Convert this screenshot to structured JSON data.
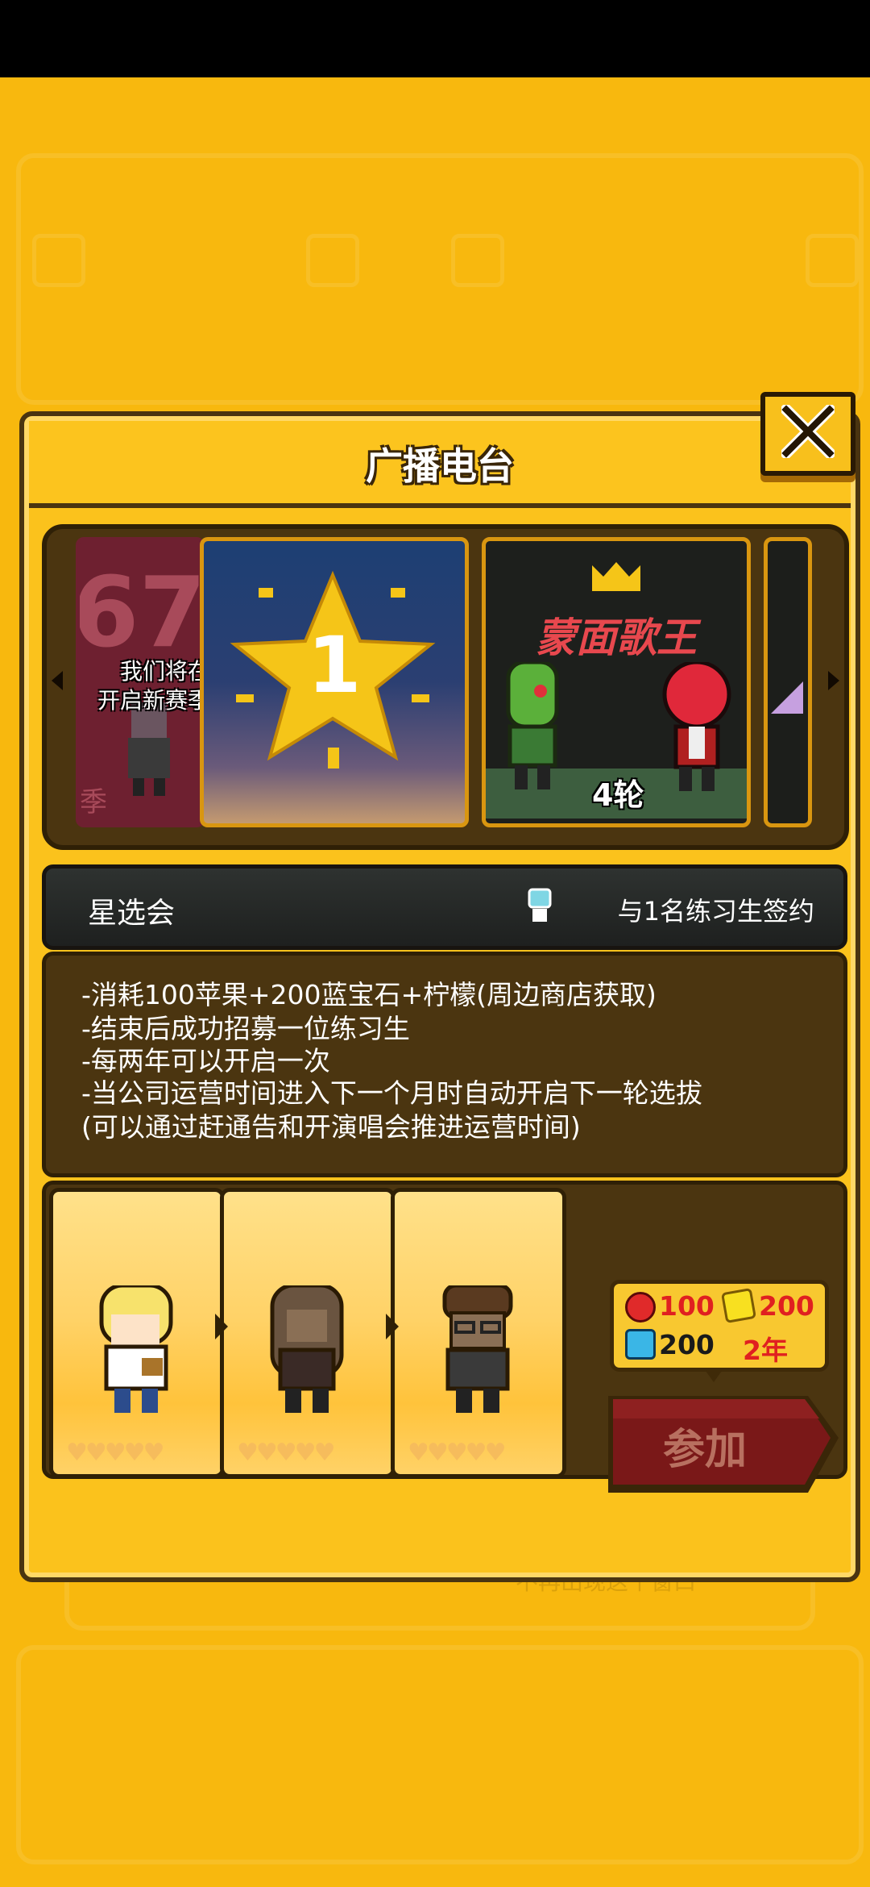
{
  "dialog": {
    "title": "广播电台"
  },
  "carousel": {
    "card1_text_line1": "我们将在",
    "card1_text_line2": "开启新赛季",
    "card1_big_digits": "67",
    "card1_bottom_char": "季",
    "card2_star_number": "1",
    "card3_title": "蒙面歌王",
    "card3_round": "4轮"
  },
  "section": {
    "title": "星选会",
    "sign_text": "与1名练习生签约"
  },
  "description": {
    "lines": [
      "-消耗100苹果+200蓝宝石+柠檬(周边商店获取)",
      "-结束后成功招募一位练习生",
      "-每两年可以开启一次",
      "-当公司运营时间进入下一个月时自动开启下一轮选拔",
      "(可以通过赶通告和开演唱会推进运营时间)"
    ]
  },
  "cost": {
    "apple": "100",
    "lemon": "200",
    "sapphire": "200",
    "years": "2年"
  },
  "join_button": {
    "label": "参加"
  },
  "hearts": "♥♥♥♥♥",
  "background": {
    "faint_text": "不再出现这个窗口"
  },
  "colors": {
    "background": "#f8b80e",
    "panel_dark": "#4b3510",
    "join_button": "#7a1818",
    "price_red": "#e02020"
  }
}
